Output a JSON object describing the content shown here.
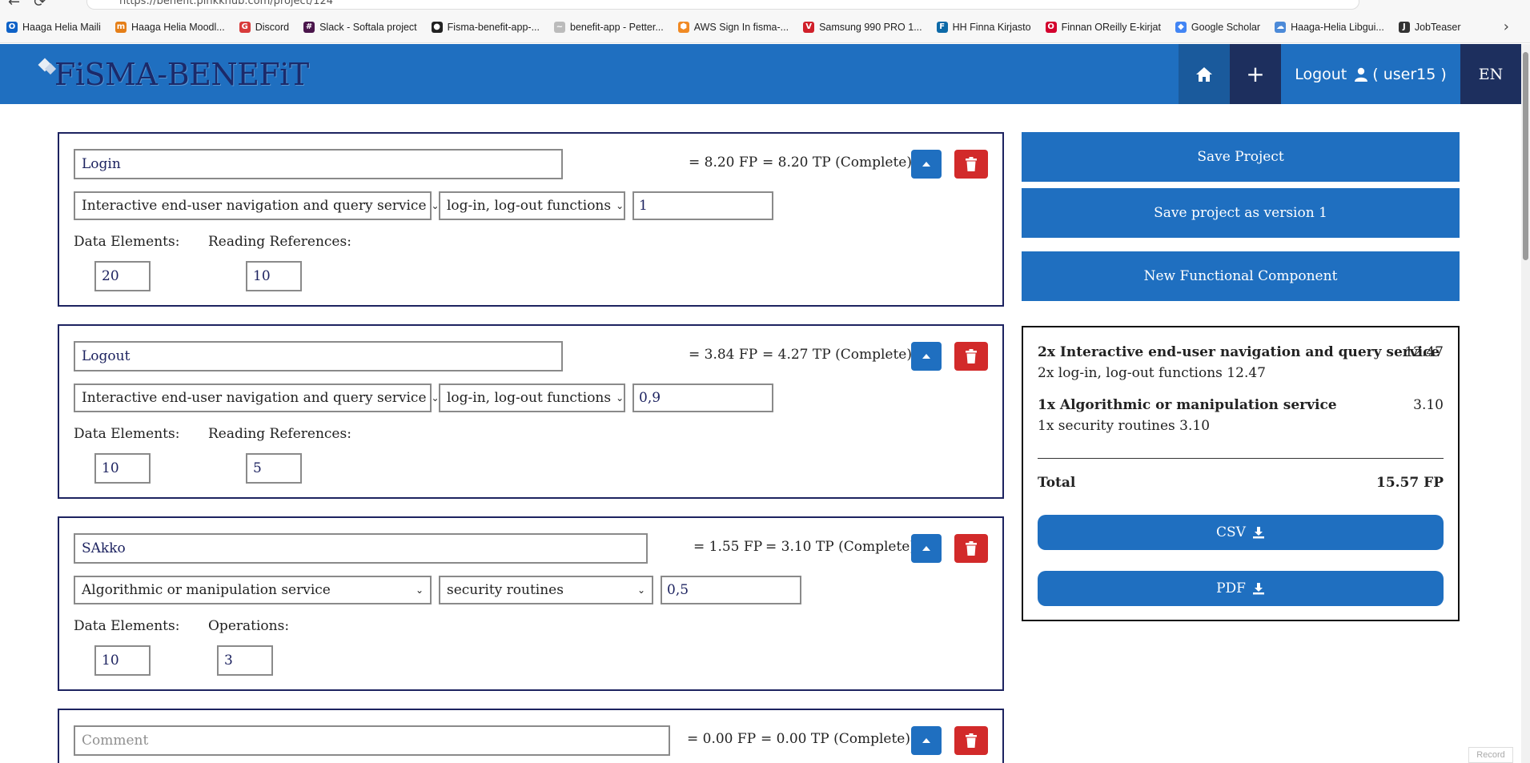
{
  "browser": {
    "url": "https://benefit.pinkkhub.com/project/124",
    "bookmarks": [
      {
        "label": "Haaga Helia Maili",
        "icon": "outlook-icon",
        "color": "#0f62c7",
        "glyph": "O"
      },
      {
        "label": "Haaga Helia Moodl...",
        "icon": "moodle-icon",
        "color": "#e57f18",
        "glyph": "m"
      },
      {
        "label": "Discord",
        "icon": "discord-icon",
        "color": "#d83b3b",
        "glyph": "G"
      },
      {
        "label": "Slack - Softala project",
        "icon": "slack-icon",
        "color": "#4a154b",
        "glyph": "#"
      },
      {
        "label": "Fisma-benefit-app-...",
        "icon": "github-icon",
        "color": "#222222",
        "glyph": "●"
      },
      {
        "label": "benefit-app - Petter...",
        "icon": "app-icon",
        "color": "#bbbbbb",
        "glyph": "~"
      },
      {
        "label": "AWS Sign In fisma-...",
        "icon": "aws-icon",
        "color": "#f08a24",
        "glyph": "⬢"
      },
      {
        "label": "Samsung 990 PRO 1...",
        "icon": "verkkokauppa-icon",
        "color": "#d0202a",
        "glyph": "V"
      },
      {
        "label": "HH Finna Kirjasto",
        "icon": "finna-icon",
        "color": "#0d6aa8",
        "glyph": "F"
      },
      {
        "label": "Finnan OReilly E-kirjat",
        "icon": "oreilly-icon",
        "color": "#d3002d",
        "glyph": "O"
      },
      {
        "label": "Google Scholar",
        "icon": "scholar-icon",
        "color": "#4285f4",
        "glyph": "◆"
      },
      {
        "label": "Haaga-Helia Libgui...",
        "icon": "libguides-icon",
        "color": "#4c8ad8",
        "glyph": "☁"
      },
      {
        "label": "JobTeaser",
        "icon": "jobteaser-icon",
        "color": "#333333",
        "glyph": "J"
      }
    ]
  },
  "header": {
    "logo": "FiSMA-BENEFiT",
    "logout_label": "Logout",
    "user_label": "( user15 )",
    "lang": "EN",
    "add_label": "+"
  },
  "components": [
    {
      "name": "Login",
      "placeholder": "",
      "fp": "= 8.20 FP",
      "tp": "= 8.20 TP (Complete)",
      "class": "Interactive end-user navigation and query service",
      "type": "log-in, log-out functions",
      "multiplier": "1",
      "field1_label": "Data Elements:",
      "field1_value": "20",
      "field2_label": "Reading References:",
      "field2_value": "10"
    },
    {
      "name": "Logout",
      "placeholder": "",
      "fp": "= 3.84 FP",
      "tp": "= 4.27 TP (Complete)",
      "class": "Interactive end-user navigation and query service",
      "type": "log-in, log-out functions",
      "multiplier": "0,9",
      "field1_label": "Data Elements:",
      "field1_value": "10",
      "field2_label": "Reading References:",
      "field2_value": "5"
    },
    {
      "name": "SAkko",
      "placeholder": "",
      "fp": "= 1.55 FP",
      "tp": "= 3.10 TP (Complete)",
      "class": "Algorithmic or manipulation service",
      "type": "security routines",
      "multiplier": "0,5",
      "field1_label": "Data Elements:",
      "field1_value": "10",
      "field2_label": "Operations:",
      "field2_value": "3"
    },
    {
      "name": "",
      "placeholder": "Comment",
      "fp": "= 0.00 FP",
      "tp": "= 0.00 TP (Complete)"
    }
  ],
  "actions": {
    "save_project": "Save Project",
    "save_version": "Save project as version 1",
    "new_component": "New Functional Component"
  },
  "summary": {
    "groups": [
      {
        "title": "2x Interactive end-user navigation and query service",
        "title_value": "12.47",
        "sub": "2x log-in, log-out functions 12.47"
      },
      {
        "title": "1x Algorithmic or manipulation service",
        "title_value": "3.10",
        "sub": "1x security routines 3.10"
      }
    ],
    "total_label": "Total",
    "total_value": "15.57 FP",
    "csv_label": "CSV",
    "pdf_label": "PDF"
  },
  "record_label": "Record",
  "colors": {
    "primary": "#1f6fc0",
    "dark_navy": "#1d2f5e",
    "danger": "#d22a2a",
    "border": "#1d2360"
  }
}
